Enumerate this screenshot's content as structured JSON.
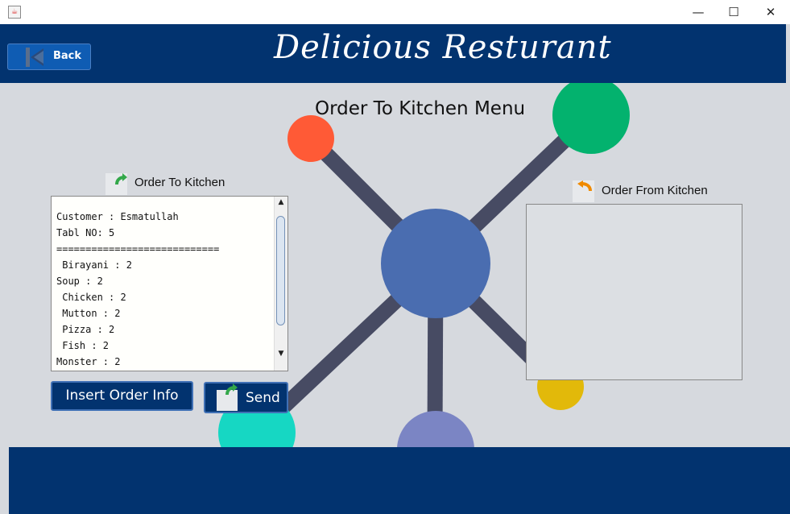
{
  "window": {
    "minimize_glyph": "—",
    "maximize_glyph": "☐",
    "close_glyph": "✕",
    "app_icon": "java-cup-icon"
  },
  "header": {
    "back_label": "Back",
    "back_icon": "back-arrow-icon",
    "title": "Delicious Resturant"
  },
  "page": {
    "heading": "Order To Kitchen Menu"
  },
  "order_to_kitchen": {
    "label": "Order To Kitchen",
    "icon": "green-forward-arrow-icon",
    "lines": [
      "Customer : Esmatullah",
      "Tabl NO: 5",
      "============================",
      " Birayani : 2",
      "Soup : 2",
      " Chicken : 2",
      " Mutton : 2",
      " Pizza : 2",
      " Fish : 2",
      "Monster : 2"
    ]
  },
  "order_from_kitchen": {
    "label": "Order From Kitchen",
    "icon": "orange-return-arrow-icon"
  },
  "buttons": {
    "insert_order_info": "Insert Order Info",
    "send": "Send"
  },
  "colors": {
    "header_bg": "#02336f",
    "background": "#d6d9de",
    "hub_circle": "#4a6db0",
    "red_circle": "#ff5a36",
    "green_circle": "#03b26e",
    "yellow_circle": "#e2b90a",
    "teal_circle": "#16d7c3",
    "purple_circle": "#7b85c4",
    "spoke": "#474b63"
  }
}
